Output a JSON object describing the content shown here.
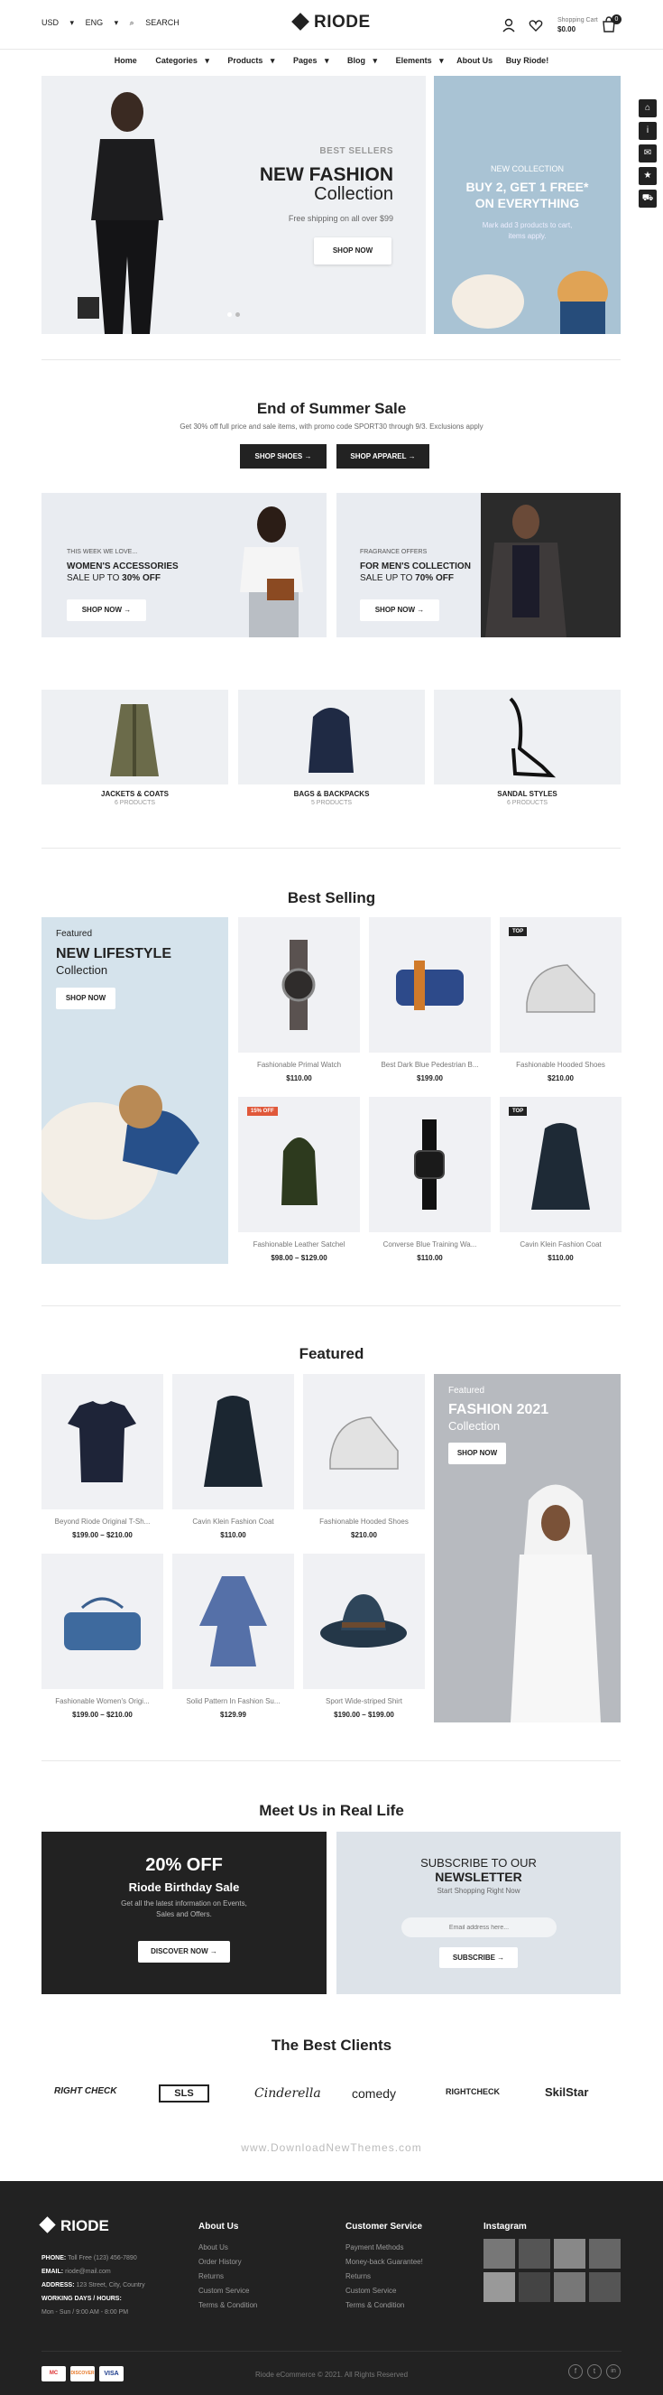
{
  "topbar": {
    "currency": "USD",
    "language": "ENG",
    "search_label": "SEARCH"
  },
  "logo": {
    "text": "RIODE"
  },
  "cart": {
    "label": "Shopping Cart",
    "amount": "$0.00",
    "count": "0"
  },
  "nav": [
    "Home",
    "Categories",
    "Products",
    "Pages",
    "Blog",
    "Elements",
    "About Us",
    "Buy Riode!"
  ],
  "hero": {
    "kicker": "BEST SELLERS",
    "title": "NEW FASHION",
    "subtitle": "Collection",
    "text": "Free shipping on all over $99",
    "button": "SHOP NOW",
    "side_kicker": "NEW COLLECTION",
    "side_title": "BUY 2, GET 1 FREE* ON EVERYTHING",
    "side_text": "Mark add 3 products to cart, items apply."
  },
  "summer": {
    "title": "End of Summer Sale",
    "text": "Get 30% off full price and sale items, with promo code SPORT30 through 9/3. Exclusions apply",
    "btn_shoes": "SHOP SHOES",
    "btn_apparel": "SHOP APPAREL"
  },
  "banners": [
    {
      "kicker": "THIS WEEK WE LOVE...",
      "title": "WOMEN'S ACCESSORIES",
      "sale": "SALE UP TO",
      "pct": "30% OFF",
      "button": "SHOP NOW"
    },
    {
      "kicker": "FRAGRANCE OFFERS",
      "title": "FOR MEN'S COLLECTION",
      "sale": "SALE UP TO",
      "pct": "70% OFF",
      "button": "SHOP NOW"
    }
  ],
  "categories": [
    {
      "name": "JACKETS & COATS",
      "count": "6 PRODUCTS"
    },
    {
      "name": "BAGS & BACKPACKS",
      "count": "5 PRODUCTS"
    },
    {
      "name": "SANDAL STYLES",
      "count": "6 PRODUCTS"
    }
  ],
  "best_selling": {
    "title": "Best Selling",
    "promo": {
      "kicker": "Featured",
      "title": "NEW LIFESTYLE",
      "subtitle": "Collection",
      "button": "SHOP NOW"
    },
    "products": [
      {
        "name": "Fashionable Primal Watch",
        "price": "$110.00",
        "badge": ""
      },
      {
        "name": "Best Dark Blue Pedestrian B...",
        "price": "$199.00",
        "badge": ""
      },
      {
        "name": "Fashionable Hooded Shoes",
        "price": "$210.00",
        "badge": "TOP"
      },
      {
        "name": "Fashionable Leather Satchel",
        "price": "$98.00 – $129.00",
        "badge": "15% OFF"
      },
      {
        "name": "Converse Blue Training Wa...",
        "price": "$110.00",
        "badge": ""
      },
      {
        "name": "Cavin Klein Fashion Coat",
        "price": "$110.00",
        "badge": "TOP"
      }
    ]
  },
  "featured": {
    "title": "Featured",
    "products": [
      {
        "name": "Beyond Riode Original T-Sh...",
        "price": "$199.00 – $210.00"
      },
      {
        "name": "Cavin Klein Fashion Coat",
        "price": "$110.00"
      },
      {
        "name": "Fashionable Hooded Shoes",
        "price": "$210.00"
      },
      {
        "name": "Fashionable Women's Origi...",
        "price": "$199.00 – $210.00"
      },
      {
        "name": "Solid Pattern In Fashion Su...",
        "price": "$129.99"
      },
      {
        "name": "Sport Wide-striped Shirt",
        "price": "$190.00 – $199.00"
      }
    ],
    "promo": {
      "kicker": "Featured",
      "title": "FASHION 2021",
      "subtitle": "Collection",
      "button": "SHOP NOW"
    }
  },
  "meet": {
    "title": "Meet Us in Real Life",
    "sale_pct": "20% OFF",
    "sale_title": "Riode Birthday Sale",
    "sale_text": "Get all the latest information on Events, Sales and Offers.",
    "sale_button": "DISCOVER NOW",
    "news_kicker": "SUBSCRIBE TO OUR",
    "news_title": "NEWSLETTER",
    "news_text": "Start Shopping Right Now",
    "news_placeholder": "Email address here...",
    "news_button": "SUBSCRIBE"
  },
  "clients": {
    "title": "The Best Clients",
    "logos": [
      "RIGHT CHECK",
      "SLS",
      "Cinderella",
      "comedy",
      "RIGHTCHECK",
      "SkilStar"
    ]
  },
  "watermark": "www.DownloadNewThemes.com",
  "footer": {
    "logo": "RIODE",
    "phone_label": "PHONE:",
    "phone": "Toll Free (123) 456-7890",
    "email_label": "EMAIL:",
    "email": "riode@mail.com",
    "address_label": "ADDRESS:",
    "address": "123 Street, City, Country",
    "hours_label": "WORKING DAYS / HOURS:",
    "hours": "Mon - Sun / 9:00 AM - 8:00 PM",
    "about_title": "About Us",
    "about_items": [
      "About Us",
      "Order History",
      "Returns",
      "Custom Service",
      "Terms & Condition"
    ],
    "service_title": "Customer Service",
    "service_items": [
      "Payment Methods",
      "Money-back Guarantee!",
      "Returns",
      "Custom Service",
      "Terms & Condition"
    ],
    "instagram_title": "Instagram",
    "payments": [
      "MC",
      "DISCOVER",
      "VISA"
    ],
    "copyright": "Riode eCommerce © 2021. All Rights Reserved"
  }
}
